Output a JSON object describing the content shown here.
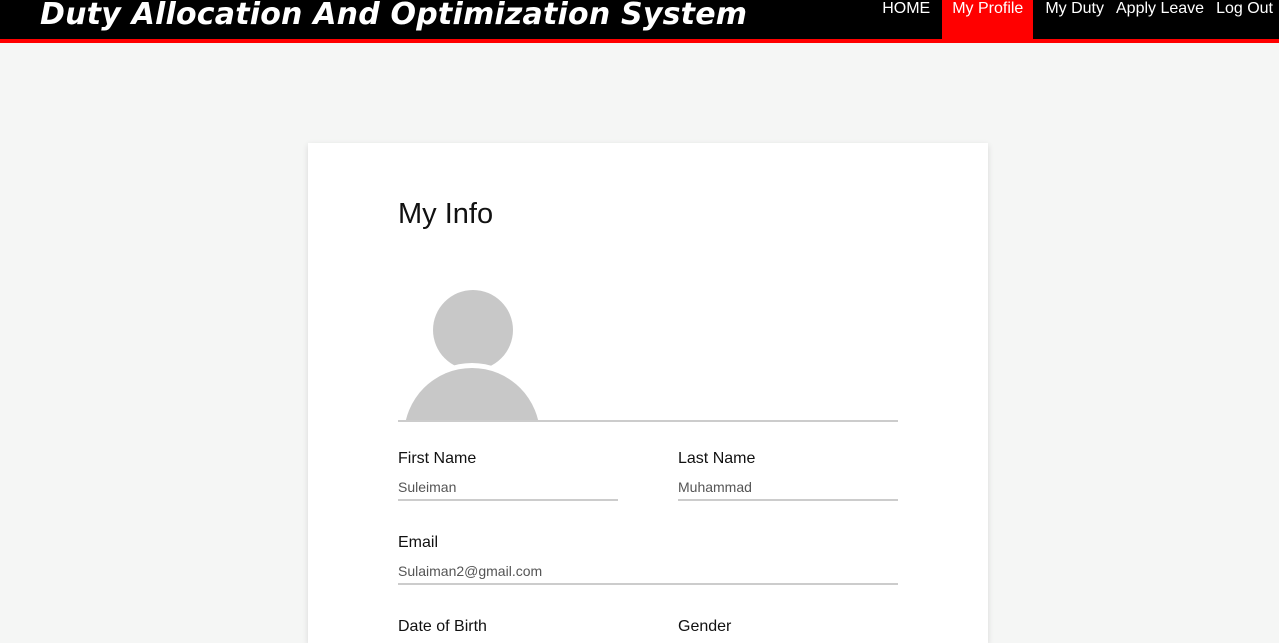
{
  "header": {
    "brand": "Duty Allocation And Optimization System",
    "nav": [
      {
        "label": "HOME",
        "active": false
      },
      {
        "label": "My Profile",
        "active": true
      },
      {
        "label": "My Duty",
        "active": false
      },
      {
        "label": "Apply Leave",
        "active": false
      },
      {
        "label": "Log Out",
        "active": false
      }
    ],
    "colors": {
      "bar": "#000000",
      "accent": "#ff0000"
    }
  },
  "profile": {
    "title": "My Info",
    "avatar_icon": "user-avatar-icon",
    "fields": {
      "first_name": {
        "label": "First Name",
        "value": "Suleiman"
      },
      "last_name": {
        "label": "Last Name",
        "value": "Muhammad"
      },
      "email": {
        "label": "Email",
        "value": "Sulaiman2@gmail.com"
      },
      "dob": {
        "label": "Date of Birth"
      },
      "gender": {
        "label": "Gender"
      }
    }
  }
}
